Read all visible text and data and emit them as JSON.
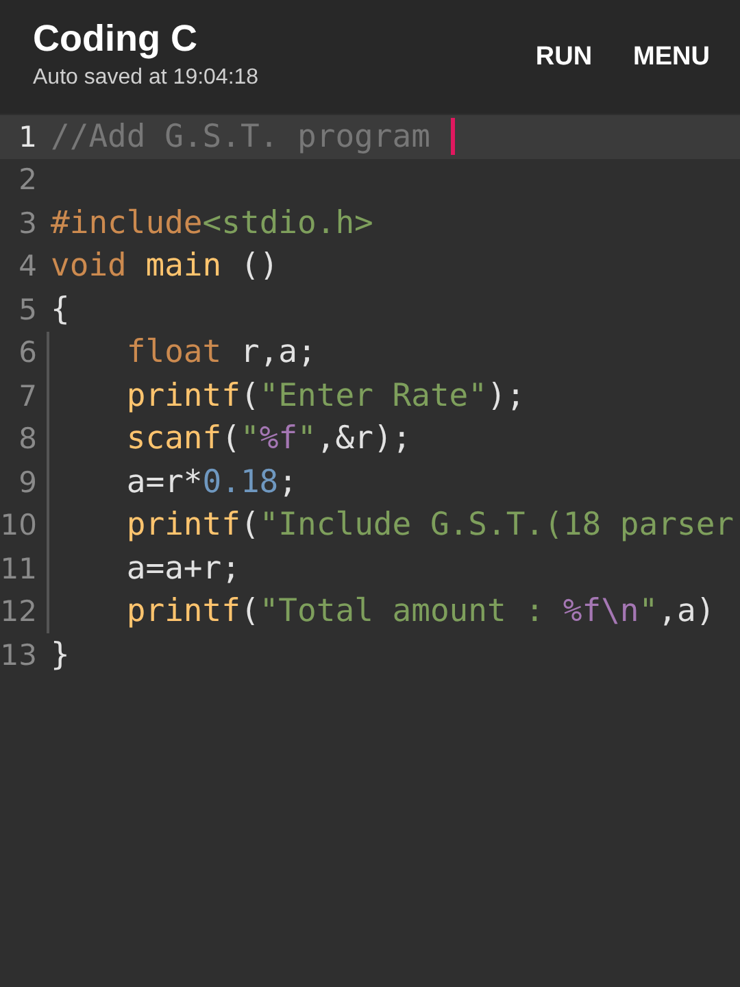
{
  "app_bar": {
    "title": "Coding C",
    "subtitle": "Auto saved at 19:04:18",
    "actions": [
      "RUN",
      "MENU"
    ]
  },
  "editor": {
    "lines": [
      {
        "number": "1",
        "current": true,
        "indented": false,
        "tokens": [
          {
            "kind": "comment",
            "text": "//Add G.S.T. program "
          }
        ]
      },
      {
        "number": "2",
        "current": false,
        "indented": false
      },
      {
        "number": "3",
        "current": false,
        "indented": false,
        "tokens": [
          {
            "kind": "keyword",
            "text": "#include"
          },
          {
            "kind": "string",
            "text": "<stdio.h>"
          }
        ]
      },
      {
        "number": "4",
        "current": false,
        "indented": false,
        "tokens": [
          {
            "kind": "keyword",
            "text": "void"
          },
          {
            "kind": "function",
            "text": " main"
          },
          {
            "kind": "plain",
            "text": " ()"
          }
        ]
      },
      {
        "number": "5",
        "current": false,
        "indented": false,
        "tokens": [
          {
            "kind": "plain",
            "text": "{"
          }
        ]
      },
      {
        "number": "6",
        "current": false,
        "indented": true,
        "tokens": [
          {
            "kind": "keyword",
            "text": "float"
          },
          {
            "kind": "plain",
            "text": " r,a;"
          }
        ]
      },
      {
        "number": "7",
        "current": false,
        "indented": true,
        "tokens": [
          {
            "kind": "function",
            "text": "printf"
          },
          {
            "kind": "plain",
            "text": "("
          },
          {
            "kind": "string",
            "text": "\"Enter Rate\""
          },
          {
            "kind": "plain",
            "text": ");"
          }
        ]
      },
      {
        "number": "8",
        "current": false,
        "indented": true,
        "tokens": [
          {
            "kind": "function",
            "text": "scanf"
          },
          {
            "kind": "plain",
            "text": "("
          },
          {
            "kind": "string",
            "text": "\""
          },
          {
            "kind": "format",
            "text": "%f"
          },
          {
            "kind": "string",
            "text": "\""
          },
          {
            "kind": "plain",
            "text": ",&r);"
          }
        ]
      },
      {
        "number": "9",
        "current": false,
        "indented": true,
        "tokens": [
          {
            "kind": "plain",
            "text": "a=r*"
          },
          {
            "kind": "number",
            "text": "0.18"
          },
          {
            "kind": "plain",
            "text": ";"
          }
        ]
      },
      {
        "number": "10",
        "current": false,
        "indented": true,
        "tokens": [
          {
            "kind": "function",
            "text": "printf"
          },
          {
            "kind": "plain",
            "text": "("
          },
          {
            "kind": "string",
            "text": "\"Include G.S.T.(18 parser"
          }
        ]
      },
      {
        "number": "11",
        "current": false,
        "indented": true,
        "tokens": [
          {
            "kind": "plain",
            "text": "a=a+r;"
          }
        ]
      },
      {
        "number": "12",
        "current": false,
        "indented": true,
        "tokens": [
          {
            "kind": "function",
            "text": "printf"
          },
          {
            "kind": "plain",
            "text": "("
          },
          {
            "kind": "string",
            "text": "\"Total amount : "
          },
          {
            "kind": "format",
            "text": "%f\\n"
          },
          {
            "kind": "string",
            "text": "\""
          },
          {
            "kind": "plain",
            "text": ",a)"
          }
        ]
      },
      {
        "number": "13",
        "current": false,
        "indented": false,
        "tokens": [
          {
            "kind": "plain",
            "text": "}"
          }
        ]
      }
    ]
  }
}
